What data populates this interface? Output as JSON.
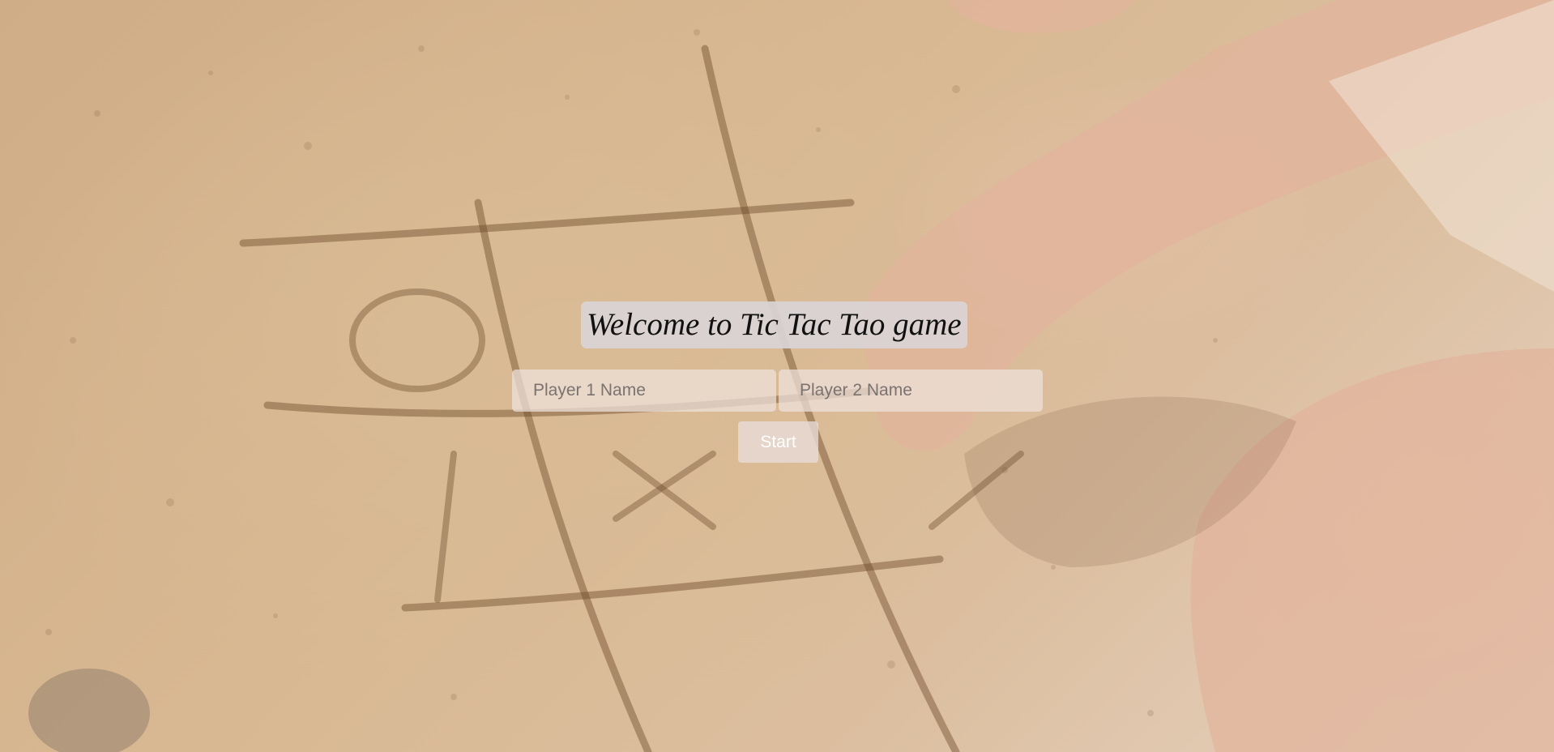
{
  "page": {
    "title": "Welcome to Tic Tac Tao game"
  },
  "form": {
    "player1_placeholder": "Player 1 Name",
    "player1_value": "",
    "player2_placeholder": "Player 2 Name",
    "player2_value": "",
    "start_label": "Start"
  },
  "background": {
    "subject": "tic-tac-toe grid drawn in sand with hands",
    "sand_color": "#d5b48c",
    "skin_color": "#e2b9a3"
  }
}
